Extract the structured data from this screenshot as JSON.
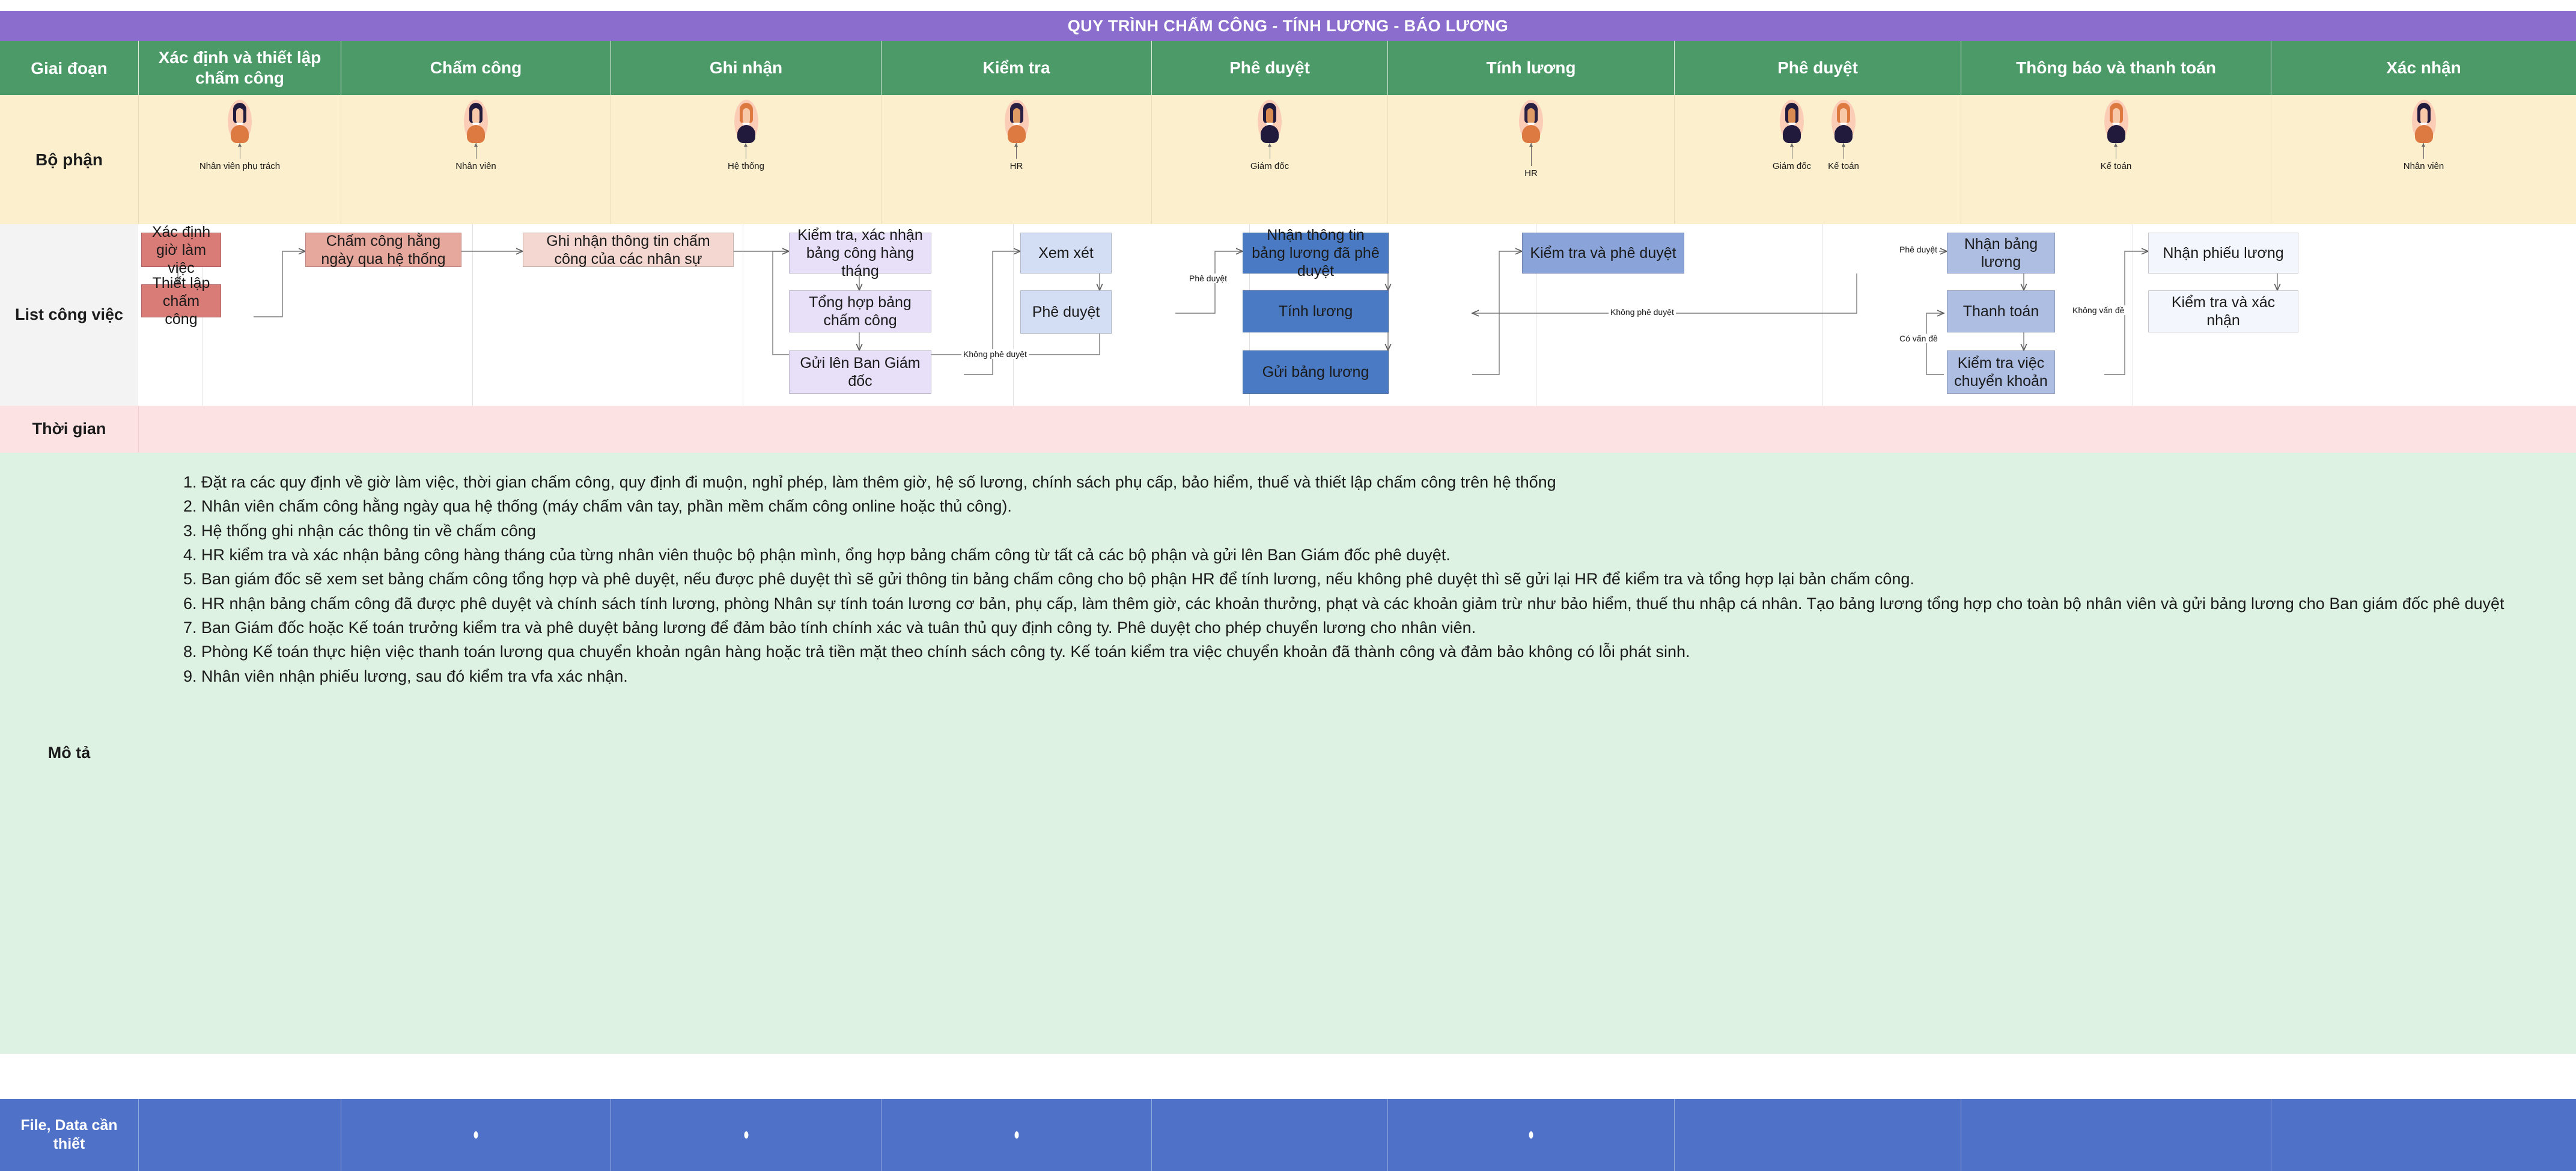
{
  "title": "QUY TRÌNH CHẤM CÔNG - TÍNH LƯƠNG - BÁO LƯƠNG",
  "row_labels": {
    "stage": "Giai đoạn",
    "department": "Bộ phận",
    "tasks": "List công việc",
    "time": "Thời gian",
    "description": "Mô tả",
    "files": "File, Data cần thiết"
  },
  "stages": [
    "Xác định và thiết lập chấm công",
    "Chấm công",
    "Ghi nhận",
    "Kiểm tra",
    "Phê duyệt",
    "Tính lương",
    "Phê duyệt",
    "Thông báo và thanh toán",
    "Xác nhận"
  ],
  "departments": [
    {
      "people": [
        "Nhân viên phụ trách"
      ]
    },
    {
      "people": [
        "Nhân viên"
      ]
    },
    {
      "people": [
        "Hệ thống"
      ]
    },
    {
      "people": [
        "HR"
      ]
    },
    {
      "people": [
        "Giám đốc"
      ]
    },
    {
      "people": [
        "HR"
      ]
    },
    {
      "people": [
        "Giám đốc",
        "Kế toán"
      ]
    },
    {
      "people": [
        "Kế toán"
      ]
    },
    {
      "people": [
        "Nhân viên"
      ]
    }
  ],
  "nodes": [
    {
      "id": "n1",
      "label": "Xác định giờ làm việc"
    },
    {
      "id": "n2",
      "label": "Thiết lập chấm công"
    },
    {
      "id": "n3",
      "label": "Chấm công hằng ngày qua hệ thống"
    },
    {
      "id": "n4",
      "label": "Ghi nhận thông tin chấm công của các nhân sự"
    },
    {
      "id": "n5",
      "label": "Kiểm tra, xác nhận bảng công hàng tháng"
    },
    {
      "id": "n6",
      "label": "Tổng hợp bảng chấm công"
    },
    {
      "id": "n7",
      "label": "Gửi lên Ban Giám đốc"
    },
    {
      "id": "n8",
      "label": "Xem xét"
    },
    {
      "id": "n9",
      "label": "Phê duyệt"
    },
    {
      "id": "n10",
      "label": "Nhận thông tin bảng lương đã phê duyệt"
    },
    {
      "id": "n11",
      "label": "Tính lương"
    },
    {
      "id": "n12",
      "label": "Gửi bảng lương"
    },
    {
      "id": "n13",
      "label": "Kiểm tra và phê duyệt"
    },
    {
      "id": "n14",
      "label": "Nhận bảng lương"
    },
    {
      "id": "n15",
      "label": "Thanh toán"
    },
    {
      "id": "n16",
      "label": "Kiểm tra việc chuyển khoản"
    },
    {
      "id": "n17",
      "label": "Nhận phiếu lương"
    },
    {
      "id": "n18",
      "label": "Kiểm tra và xác nhận"
    }
  ],
  "edge_labels": [
    {
      "id": "e1",
      "text": "Phê duyệt"
    },
    {
      "id": "e2",
      "text": "Không phê duyệt"
    },
    {
      "id": "e3",
      "text": "Không phê duyệt"
    },
    {
      "id": "e4",
      "text": "Phê duyệt"
    },
    {
      "id": "e5",
      "text": "Có vấn đề"
    },
    {
      "id": "e6",
      "text": "Không vấn đề"
    }
  ],
  "description_items": [
    "Đặt ra các quy định về giờ làm việc, thời gian chấm công, quy định đi muộn, nghỉ phép, làm thêm giờ, hệ số lương, chính sách phụ cấp, bảo hiểm, thuế và thiết lập chấm công trên hệ thống",
    "Nhân viên chấm công hằng ngày qua hệ thống (máy chấm vân tay, phần mềm chấm công online hoặc thủ công).",
    "Hệ thống ghi nhận các thông tin về chấm công",
    "HR kiểm tra và xác nhận bảng công hàng tháng của từng nhân viên thuộc bộ phận mình, ổng hợp bảng chấm công từ tất cả các bộ phận và gửi lên Ban Giám đốc phê duyệt.",
    "Ban giám đốc sẽ xem set bảng chấm công tổng hợp và phê duyệt, nếu được phê duyệt thì sẽ gửi thông tin bảng chấm công cho bộ phận HR để tính lương, nếu không phê duyệt thì sẽ gửi lại HR để kiểm tra và tổng hợp lại bản chấm công.",
    "HR nhận bảng chấm công đã được phê duyệt và chính sách tính lương, phòng Nhân sự tính toán lương cơ bản, phụ cấp, làm thêm giờ, các khoản thưởng, phạt và các khoản giảm trừ như bảo hiểm, thuế thu nhập cá nhân. Tạo bảng lương tổng hợp cho toàn bộ nhân viên và gửi bảng lương cho Ban giám đốc phê duyệt",
    "Ban Giám đốc hoặc Kế toán trưởng kiểm tra và phê duyệt bảng lương để đảm bảo tính chính xác và tuân thủ quy định công ty. Phê duyệt cho phép chuyển lương cho nhân viên.",
    "Phòng Kế toán thực hiện việc thanh toán lương qua chuyển khoản ngân hàng hoặc trả tiền mặt theo chính sách công ty. Kế toán kiểm tra việc chuyển khoản đã thành công và đảm bảo không có lỗi phát sinh.",
    "Nhân viên nhận phiếu lương, sau đó kiểm tra vfa xác nhận."
  ],
  "file_row_dots": [
    false,
    true,
    true,
    true,
    false,
    true,
    false,
    false,
    false
  ],
  "colors": {
    "title_bar": "#8a6dcd",
    "stage_header": "#4b9a68",
    "department_band": "#fcefcd",
    "task_band": "#f3f3f3",
    "time_band": "#fde2e4",
    "description_band": "#ddf2e2",
    "file_band": "#4f72c8",
    "node_red_dark": "#d97b76",
    "node_red_mid": "#e6a79d",
    "node_red_light": "#f3d7d0",
    "node_purple": "#e8dff8",
    "node_periwinkle": "#d3ddf4",
    "node_blue_dark": "#4a7ac4",
    "node_blue_mid": "#8aa4da",
    "node_blue_soft": "#aebee3",
    "node_white": "#f3f6fc"
  }
}
